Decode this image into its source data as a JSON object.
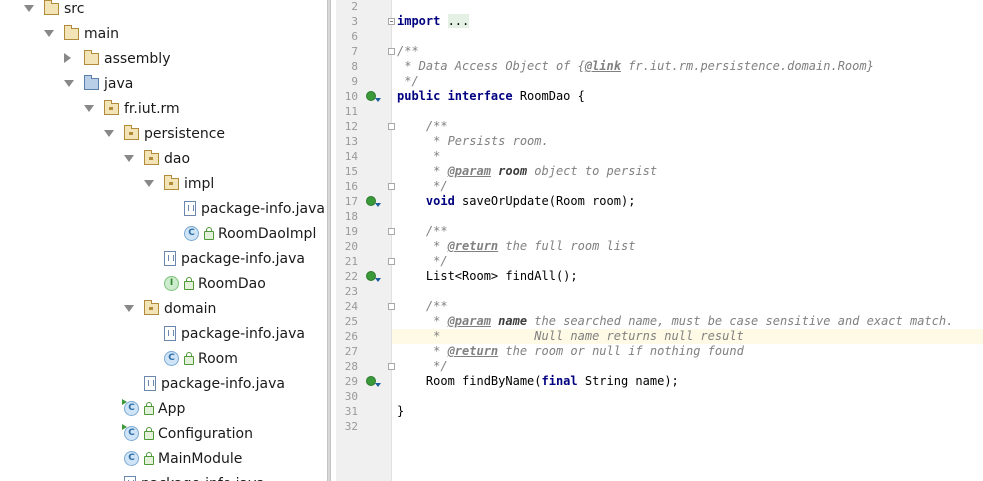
{
  "tree": [
    {
      "label": "src",
      "icon": "folder-icon",
      "type": "folder",
      "arrow": "down"
    },
    {
      "label": "main",
      "icon": "folder-icon",
      "type": "folder",
      "arrow": "down"
    },
    {
      "label": "assembly",
      "icon": "folder-icon",
      "type": "folder",
      "arrow": "right"
    },
    {
      "label": "java",
      "icon": "source-folder-icon",
      "type": "src",
      "arrow": "down"
    },
    {
      "label": "fr.iut.rm",
      "icon": "package-icon",
      "type": "pkg",
      "arrow": "down"
    },
    {
      "label": "persistence",
      "icon": "package-icon",
      "type": "pkg",
      "arrow": "down"
    },
    {
      "label": "dao",
      "icon": "package-icon",
      "type": "pkg",
      "arrow": "down"
    },
    {
      "label": "impl",
      "icon": "package-icon",
      "type": "pkg",
      "arrow": "down"
    },
    {
      "label": "package-info.java",
      "icon": "java-file-icon",
      "type": "jfile",
      "arrow": ""
    },
    {
      "label": "RoomDaoImpl",
      "icon": "class-icon",
      "type": "class",
      "arrow": "",
      "lock": true
    },
    {
      "label": "package-info.java",
      "icon": "java-file-icon",
      "type": "jfile",
      "arrow": ""
    },
    {
      "label": "RoomDao",
      "icon": "interface-icon",
      "type": "interface",
      "arrow": "",
      "lock": true
    },
    {
      "label": "domain",
      "icon": "package-icon",
      "type": "pkg",
      "arrow": "down"
    },
    {
      "label": "package-info.java",
      "icon": "java-file-icon",
      "type": "jfile",
      "arrow": ""
    },
    {
      "label": "Room",
      "icon": "class-icon",
      "type": "class",
      "arrow": "",
      "lock": true
    },
    {
      "label": "package-info.java",
      "icon": "java-file-icon",
      "type": "jfile",
      "arrow": ""
    },
    {
      "label": "App",
      "icon": "runnable-class-icon",
      "type": "runclass",
      "arrow": "",
      "lock": true
    },
    {
      "label": "Configuration",
      "icon": "runnable-class-icon",
      "type": "runclass",
      "arrow": "",
      "lock": true
    },
    {
      "label": "MainModule",
      "icon": "class-icon",
      "type": "class",
      "arrow": "",
      "lock": true
    },
    {
      "label": "package-info.java",
      "icon": "java-file-icon",
      "type": "jfile",
      "arrow": ""
    }
  ],
  "editor": {
    "line_numbers": [
      "2",
      "3",
      "6",
      "7",
      "8",
      "9",
      "10",
      "11",
      "12",
      "13",
      "14",
      "15",
      "16",
      "17",
      "18",
      "19",
      "20",
      "21",
      "22",
      "23",
      "24",
      "25",
      "26",
      "27",
      "28",
      "29",
      "30",
      "31",
      "32"
    ],
    "highlighted_line": "26",
    "lines": [
      [],
      [
        {
          "t": "import ",
          "c": "kw"
        },
        {
          "t": "...",
          "c": "fold-dots"
        }
      ],
      [],
      [
        {
          "t": "/**",
          "c": "cm"
        }
      ],
      [
        {
          "t": " * Data Access Object of {",
          "c": "cm"
        },
        {
          "t": "@link",
          "c": "tag"
        },
        {
          "t": " fr.iut.rm.persistence.domain.Room}",
          "c": "cm"
        }
      ],
      [
        {
          "t": " */",
          "c": "cm"
        }
      ],
      [
        {
          "t": "public interface ",
          "c": "kw"
        },
        {
          "t": "RoomDao {",
          "c": ""
        }
      ],
      [],
      [
        {
          "t": "    /**",
          "c": "cm"
        }
      ],
      [
        {
          "t": "     * Persists room.",
          "c": "cm"
        }
      ],
      [
        {
          "t": "     *",
          "c": "cm"
        }
      ],
      [
        {
          "t": "     * ",
          "c": "cm"
        },
        {
          "t": "@param",
          "c": "tag"
        },
        {
          "t": " ",
          "c": "cm"
        },
        {
          "t": "room",
          "c": "pn"
        },
        {
          "t": " object to persist",
          "c": "cm"
        }
      ],
      [
        {
          "t": "     */",
          "c": "cm"
        }
      ],
      [
        {
          "t": "    ",
          "c": ""
        },
        {
          "t": "void ",
          "c": "kw"
        },
        {
          "t": "saveOrUpdate(Room room);",
          "c": ""
        }
      ],
      [],
      [
        {
          "t": "    /**",
          "c": "cm"
        }
      ],
      [
        {
          "t": "     * ",
          "c": "cm"
        },
        {
          "t": "@return",
          "c": "tag"
        },
        {
          "t": " the full room list",
          "c": "cm"
        }
      ],
      [
        {
          "t": "     */",
          "c": "cm"
        }
      ],
      [
        {
          "t": "    List<Room> findAll();",
          "c": ""
        }
      ],
      [],
      [
        {
          "t": "    /**",
          "c": "cm"
        }
      ],
      [
        {
          "t": "     * ",
          "c": "cm"
        },
        {
          "t": "@param",
          "c": "tag"
        },
        {
          "t": " ",
          "c": "cm"
        },
        {
          "t": "name",
          "c": "pn"
        },
        {
          "t": " the searched name, must be case sensitive and exact match.",
          "c": "cm"
        }
      ],
      [
        {
          "t": "     *             Null name returns null result",
          "c": "cm"
        }
      ],
      [
        {
          "t": "     * ",
          "c": "cm"
        },
        {
          "t": "@return",
          "c": "tag"
        },
        {
          "t": " the room or null if nothing found",
          "c": "cm"
        }
      ],
      [
        {
          "t": "     */",
          "c": "cm"
        }
      ],
      [
        {
          "t": "    Room findByName(",
          "c": ""
        },
        {
          "t": "final ",
          "c": "kw"
        },
        {
          "t": "String name);",
          "c": ""
        }
      ],
      [],
      [
        {
          "t": "}",
          "c": ""
        }
      ],
      []
    ]
  }
}
